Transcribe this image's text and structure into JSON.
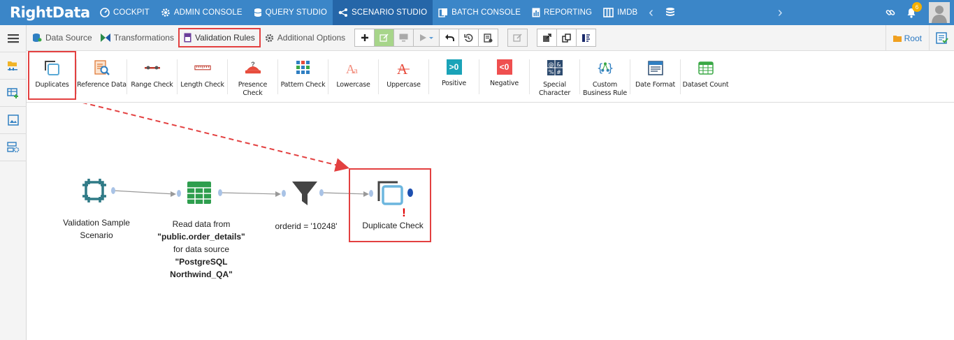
{
  "app": {
    "logo_text": "RightData"
  },
  "nav": {
    "items": [
      {
        "label": "COCKPIT",
        "icon": "speedometer-icon",
        "active": false
      },
      {
        "label": "ADMIN CONSOLE",
        "icon": "gear-icon",
        "active": false
      },
      {
        "label": "QUERY STUDIO",
        "icon": "database-icon",
        "active": false
      },
      {
        "label": "SCENARIO STUDIO",
        "icon": "flow-icon",
        "active": true
      },
      {
        "label": "BATCH CONSOLE",
        "icon": "batch-icon",
        "active": false
      },
      {
        "label": "REPORTING",
        "icon": "report-icon",
        "active": false
      },
      {
        "label": "IMDB",
        "icon": "columns-icon",
        "active": false
      }
    ],
    "notification_count": "6"
  },
  "toolbar": {
    "tabs": [
      {
        "label": "Data Source",
        "icon": "datasource-icon"
      },
      {
        "label": "Transformations",
        "icon": "transform-icon"
      },
      {
        "label": "Validation Rules",
        "icon": "validation-icon",
        "highlighted": true
      },
      {
        "label": "Additional Options",
        "icon": "gear-icon"
      }
    ],
    "root_label": "Root"
  },
  "rules": [
    {
      "label": "Duplicates",
      "icon": "duplicates-icon",
      "highlighted": true
    },
    {
      "label": "Reference Data",
      "icon": "reference-data-icon"
    },
    {
      "label": "Range Check",
      "icon": "range-check-icon"
    },
    {
      "label": "Length Check",
      "icon": "length-check-icon"
    },
    {
      "label": "Presence Check",
      "icon": "presence-check-icon"
    },
    {
      "label": "Pattern Check",
      "icon": "pattern-check-icon"
    },
    {
      "label": "Lowercase",
      "icon": "lowercase-icon"
    },
    {
      "label": "Uppercase",
      "icon": "uppercase-icon"
    },
    {
      "label": "Positive",
      "icon": "positive-icon",
      "text": ">0"
    },
    {
      "label": "Negative",
      "icon": "negative-icon",
      "text": "<0"
    },
    {
      "label": "Special Character",
      "icon": "special-character-icon"
    },
    {
      "label": "Custom Business Rule",
      "icon": "custom-rule-icon"
    },
    {
      "label": "Date Format",
      "icon": "date-format-icon"
    },
    {
      "label": "Dataset Count",
      "icon": "dataset-count-icon"
    }
  ],
  "scenario": {
    "nodes": [
      {
        "label_lines": [
          "Validation Sample",
          "Scenario"
        ]
      },
      {
        "label_lines": [
          "Read data from",
          "\"public.order_details\"",
          "for data source",
          "\"PostgreSQL",
          "Northwind_QA\""
        ]
      },
      {
        "label_lines": [
          "orderid = '10248'"
        ]
      },
      {
        "label_lines": [
          "Duplicate Check"
        ],
        "warning": "!"
      }
    ]
  },
  "colors": {
    "nav_bg": "#3b86c8",
    "nav_active": "#2566a8",
    "highlight": "#e34040",
    "node_teal": "#2f7a86",
    "port": "#a9c3e6"
  }
}
